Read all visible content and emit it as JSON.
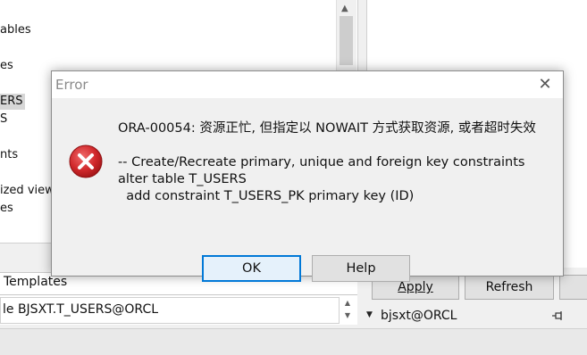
{
  "tree": {
    "items": [
      {
        "label": "ables"
      },
      {
        "label": "es"
      },
      {
        "label": "ERS"
      },
      {
        "label": "S"
      },
      {
        "label": "nts"
      },
      {
        "label": "ized views"
      },
      {
        "label": "es"
      }
    ]
  },
  "templates": {
    "label": "Templates"
  },
  "connection": {
    "text": "le BJSXT.T_USERS@ORCL"
  },
  "buttons": {
    "apply_label": "Apply",
    "refresh_label": "Refresh"
  },
  "session": {
    "label": "bjsxt@ORCL"
  },
  "dialog": {
    "title": "Error",
    "close_glyph": "✕",
    "message_lines": [
      "ORA-00054: 资源正忙, 但指定以 NOWAIT 方式获取资源, 或者超时失效",
      "-- Create/Recreate primary, unique and foreign key constraints",
      "alter table T_USERS",
      "  add constraint T_USERS_PK primary key (ID)"
    ],
    "ok_label": "OK",
    "help_label": "Help"
  },
  "colors": {
    "error_icon_red": "#d0282b",
    "ok_focus_border": "#0078d7"
  }
}
